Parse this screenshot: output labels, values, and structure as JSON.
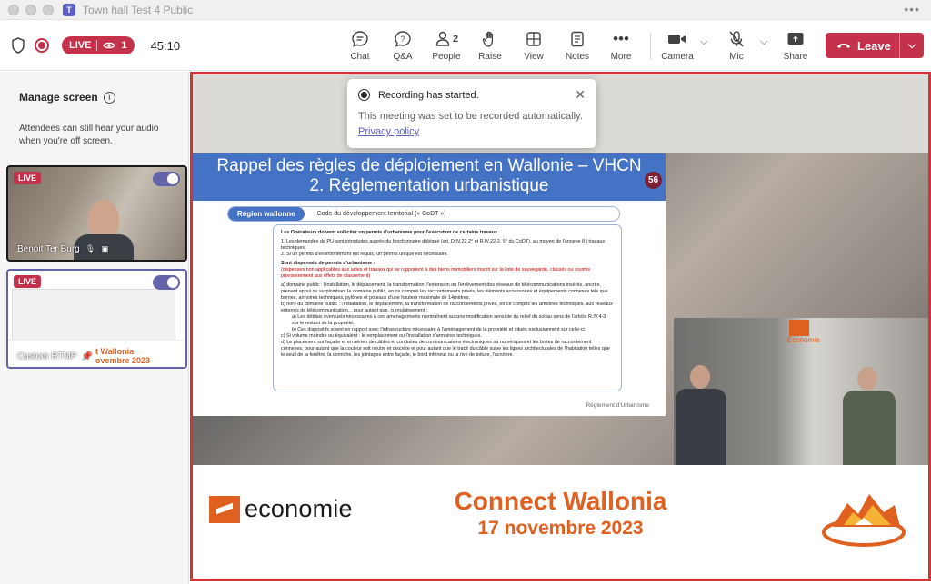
{
  "window": {
    "title": "Town hall Test 4 Public"
  },
  "toolbar": {
    "live_label": "LIVE",
    "viewer_count": "1",
    "timer": "45:10",
    "people_count": "2",
    "buttons": {
      "chat": "Chat",
      "qa": "Q&A",
      "people": "People",
      "raise": "Raise",
      "view": "View",
      "notes": "Notes",
      "more": "More",
      "camera": "Camera",
      "mic": "Mic",
      "share": "Share",
      "leave": "Leave"
    }
  },
  "sidebar": {
    "title": "Manage screen",
    "description": "Attendees can still hear your audio when you're off screen.",
    "tiles": [
      {
        "live": "LIVE",
        "name": "Benoit Ter Burg",
        "toggle_on": true
      },
      {
        "live": "LIVE",
        "name": "Custom RTMP",
        "toggle_on": true
      }
    ]
  },
  "toast": {
    "title": "Recording has started.",
    "body": "This meeting was set to be recorded automatically.",
    "link": "Privacy policy"
  },
  "slide": {
    "title_line1": "Rappel des règles de déploiement en Wallonie – VHCN",
    "title_line2": "2. Réglementation urbanistique",
    "number": "56",
    "region": "Région wallonne",
    "code": "Code du développement territorial (« CoDT »)",
    "intro": "Les Opérateurs doivent solliciter un permis d'urbanisme pour l'exécution de certains travaux",
    "point1": "1. Les demandes de PU sont introduites auprès du fonctionnaire délégué (art. D.IV.22 2° et R.IV.22-2, 5° du CoDT), au moyen de l'annexe 8 | travaux techniques.",
    "point2": "2. Si un permis d'environnement est requis, un permis unique est nécessaire.",
    "exempt_title": "Sont dispensés de permis d'urbanisme :",
    "exempt_note": "(dispenses non applicables aux actes et travaux qui se rapportent à des biens immobiliers inscrit sur la liste de sauvegarde, classés ou soumis provisoirement aux effets de classement)",
    "item_a": "a) domaine public : l'installation, le déplacement, la transformation, l'extension ou l'enlèvement des réseaux de télécommunications insérés, ancrés, prenant appui ou surplombant le domaine public, en ce compris les raccordements privés, les éléments accessoires et équipements connexes tels que bornes, armoires techniques, pylônes et poteaux d'une hauteur maximale de 14mètres.",
    "item_b": "b) hors du domaine public : l'installation, le déplacement, la transformation de raccordements privés, en ce compris les armoires techniques, aux réseaux enterrés de télécommunication... pour autant que, cumulativement :",
    "item_b_a": "a) Les déblais éventuels nécessaires à ces aménagements n'entraînent aucune modification sensible du relief du sol au sens de l'article R.IV.4-3 sur le restant de la propriété;",
    "item_b_b": "b) Ces dispositifs soient en rapport avec l'infrastructure nécessaire à l'aménagement de la propriété et situés exclusivement sur celle-ci.",
    "item_c": "c) Si volume moindre ou équivalent : le remplacement ou l'installation d'armoires techniques.",
    "item_d": "d) Le placement sur façade et en aérien de câbles et conduites de communications électroniques ou numériques et les boites de raccordement connexes, pour autant que la couleur soit neutre et discrète et pour autant que le tracé du câble suive les lignes architecturales de l'habitation telles que le seuil de la fenêtre, la corniche, les jointages entre façade, le bord inférieur ou la rive de toiture, l'acrotère.",
    "footer": "Règlement d'Urbanisme"
  },
  "inset": {
    "logo_text": "Économie"
  },
  "banner": {
    "logo_text": "economie",
    "title": "Connect Wallonia",
    "date": "17 novembre 2023",
    "mini_title": "t Wallonia",
    "mini_date": "ovembre 2023"
  },
  "colors": {
    "accent": "#6264a7",
    "live_red": "#c4314b",
    "brand_orange": "#e0601f",
    "slide_blue": "#4472c4"
  }
}
